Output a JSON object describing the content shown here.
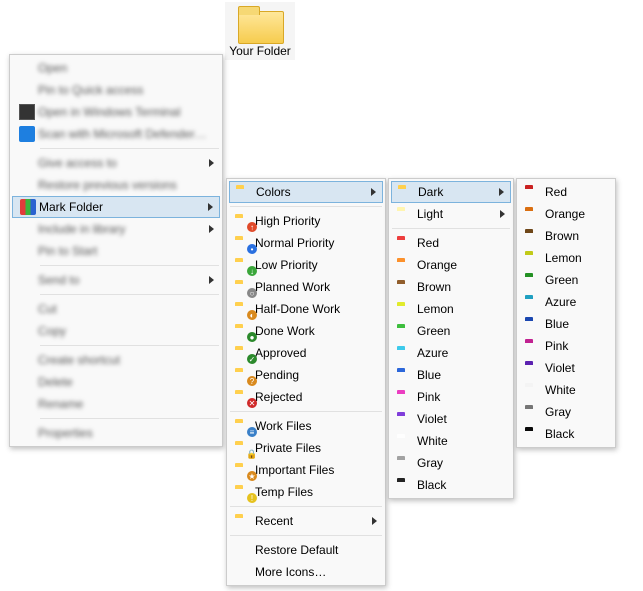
{
  "desktop": {
    "folder_label": "Your Folder"
  },
  "context_menu": {
    "items": [
      {
        "label": "Open",
        "blurred": true
      },
      {
        "label": "Pin to Quick access",
        "blurred": true
      },
      {
        "label": "Open in Windows Terminal",
        "blurred": true,
        "icon": "terminal"
      },
      {
        "label": "Scan with Microsoft Defender…",
        "blurred": true,
        "icon": "defender"
      }
    ],
    "items2": [
      {
        "label": "Give access to",
        "blurred": true,
        "arrow": true
      },
      {
        "label": "Restore previous versions",
        "blurred": true
      },
      {
        "label": "Mark Folder",
        "blurred": false,
        "arrow": true,
        "selected": true,
        "icon": "markfolder"
      },
      {
        "label": "Include in library",
        "blurred": true,
        "arrow": true
      },
      {
        "label": "Pin to Start",
        "blurred": true
      }
    ],
    "items3": [
      {
        "label": "Send to",
        "blurred": true,
        "arrow": true
      }
    ],
    "items4": [
      {
        "label": "Cut",
        "blurred": true
      },
      {
        "label": "Copy",
        "blurred": true
      }
    ],
    "items5": [
      {
        "label": "Create shortcut",
        "blurred": true
      },
      {
        "label": "Delete",
        "blurred": true
      },
      {
        "label": "Rename",
        "blurred": true
      }
    ],
    "items6": [
      {
        "label": "Properties",
        "blurred": true
      }
    ]
  },
  "mark_submenu": {
    "group1": [
      {
        "label": "Colors",
        "arrow": true,
        "selected": true,
        "color": "#f7c64a"
      }
    ],
    "group2": [
      {
        "label": "High Priority",
        "color": "#f7c64a",
        "badge": "↑",
        "badgebg": "#e04a2a"
      },
      {
        "label": "Normal Priority",
        "color": "#f7c64a",
        "badge": "•",
        "badgebg": "#2a70e0"
      },
      {
        "label": "Low Priority",
        "color": "#f7c64a",
        "badge": "↓",
        "badgebg": "#3aa63a"
      },
      {
        "label": "Planned Work",
        "color": "#f7c64a",
        "badge": "○",
        "badgebg": "#888"
      },
      {
        "label": "Half-Done Work",
        "color": "#f7c64a",
        "badge": "◐",
        "badgebg": "#d98a1e"
      },
      {
        "label": "Done Work",
        "color": "#f7c64a",
        "badge": "●",
        "badgebg": "#2c8a2c"
      },
      {
        "label": "Approved",
        "color": "#f7c64a",
        "badge": "✓",
        "badgebg": "#2c8a2c"
      },
      {
        "label": "Pending",
        "color": "#f7c64a",
        "badge": "?",
        "badgebg": "#d98a1e"
      },
      {
        "label": "Rejected",
        "color": "#f7c64a",
        "badge": "✕",
        "badgebg": "#d02a2a"
      }
    ],
    "group3": [
      {
        "label": "Work Files",
        "color": "#f7c64a",
        "badge": "≡",
        "badgebg": "#3a80c8"
      },
      {
        "label": "Private Files",
        "color": "#f7c64a",
        "badge": "🔒",
        "badgebg": "transparent"
      },
      {
        "label": "Important Files",
        "color": "#f7c64a",
        "badge": "★",
        "badgebg": "#d98a1e"
      },
      {
        "label": "Temp Files",
        "color": "#f7c64a",
        "badge": "!",
        "badgebg": "#e6c21e"
      }
    ],
    "group4": [
      {
        "label": "Recent",
        "color": "#f7c64a",
        "arrow": true
      }
    ],
    "group5": [
      {
        "label": "Restore Default"
      },
      {
        "label": "More Icons…"
      }
    ]
  },
  "colors_submenu": {
    "top": [
      {
        "label": "Dark",
        "arrow": true,
        "selected": true,
        "color": "#f7c64a"
      },
      {
        "label": "Light",
        "arrow": true,
        "color": "#f7e9a8"
      }
    ],
    "list": [
      {
        "label": "Red",
        "color": "#e23b3b"
      },
      {
        "label": "Orange",
        "color": "#f08a2a"
      },
      {
        "label": "Brown",
        "color": "#8a5a2a"
      },
      {
        "label": "Lemon",
        "color": "#d6e02a"
      },
      {
        "label": "Green",
        "color": "#3bb53b"
      },
      {
        "label": "Azure",
        "color": "#3bc0e0"
      },
      {
        "label": "Blue",
        "color": "#2a62d0"
      },
      {
        "label": "Pink",
        "color": "#e03bb8"
      },
      {
        "label": "Violet",
        "color": "#7a3bd0"
      },
      {
        "label": "White",
        "color": "#f2f2f2"
      },
      {
        "label": "Gray",
        "color": "#9a9a9a"
      },
      {
        "label": "Black",
        "color": "#222222"
      }
    ]
  },
  "dark_submenu": {
    "list": [
      {
        "label": "Red",
        "color": "#c02020"
      },
      {
        "label": "Orange",
        "color": "#d06a10"
      },
      {
        "label": "Brown",
        "color": "#6a4418"
      },
      {
        "label": "Lemon",
        "color": "#b8c018"
      },
      {
        "label": "Green",
        "color": "#228a22"
      },
      {
        "label": "Azure",
        "color": "#1e98b8"
      },
      {
        "label": "Blue",
        "color": "#1a44a8"
      },
      {
        "label": "Pink",
        "color": "#b8208a"
      },
      {
        "label": "Violet",
        "color": "#5820a8"
      },
      {
        "label": "White",
        "color": "#e8e8e8"
      },
      {
        "label": "Gray",
        "color": "#707070"
      },
      {
        "label": "Black",
        "color": "#0a0a0a"
      }
    ]
  }
}
